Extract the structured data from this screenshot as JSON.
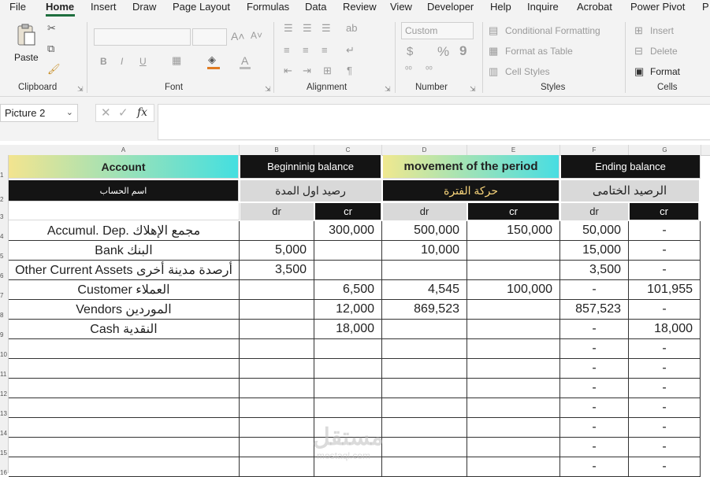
{
  "menu": [
    "File",
    "Home",
    "Insert",
    "Draw",
    "Page Layout",
    "Formulas",
    "Data",
    "Review",
    "View",
    "Developer",
    "Help",
    "Inquire",
    "Acrobat",
    "Power Pivot",
    "P"
  ],
  "ribbon": {
    "clipboard": {
      "label": "Clipboard",
      "paste": "Paste"
    },
    "font": {
      "label": "Font",
      "bold": "B",
      "italic": "I",
      "underline": "U",
      "grow": "A˄",
      "shrink": "A˅",
      "color_a": "A"
    },
    "alignment": {
      "label": "Alignment"
    },
    "number": {
      "label": "Number",
      "format_value": "Custom",
      "currency": "$",
      "percent": "%",
      "comma": "9"
    },
    "styles": {
      "label": "Styles",
      "conditional": "Conditional Formatting",
      "format_table": "Format as Table",
      "cell_styles": "Cell Styles"
    },
    "cells": {
      "label": "Cells",
      "insert": "Insert",
      "delete": "Delete",
      "format": "Format"
    }
  },
  "formula_bar": {
    "name_box": "Picture 2",
    "fx": "fx",
    "formula": ""
  },
  "columns": [
    "A",
    "B",
    "C",
    "D",
    "E",
    "F",
    "G"
  ],
  "rows": [
    "1",
    "2",
    "3",
    "4",
    "5",
    "6",
    "7",
    "8",
    "9",
    "10",
    "11",
    "12",
    "13",
    "14",
    "15",
    "16"
  ],
  "header": {
    "account": "Account",
    "beginning": "Beginninig balance",
    "movement": "movement of the period",
    "ending": "Ending balance",
    "account_ar": "اسم الحساب",
    "beginning_ar": "رصيد اول المدة",
    "movement_ar": "حركة الفترة",
    "ending_ar": "الرصيد الختامى",
    "dr": "dr",
    "cr": "cr"
  },
  "table_rows": [
    {
      "account": "Accumul. Dep. مجمع الإهلاك",
      "b_dr": "",
      "b_cr": "300,000",
      "m_dr": "500,000",
      "m_cr": "150,000",
      "e_dr": "50,000",
      "e_cr": "-"
    },
    {
      "account": "Bank البنك",
      "b_dr": "5,000",
      "b_cr": "",
      "m_dr": "10,000",
      "m_cr": "",
      "e_dr": "15,000",
      "e_cr": "-"
    },
    {
      "account": "Other Current Assets أرصدة مدينة أخرى",
      "b_dr": "3,500",
      "b_cr": "",
      "m_dr": "",
      "m_cr": "",
      "e_dr": "3,500",
      "e_cr": "-"
    },
    {
      "account": "Customer العملاء",
      "b_dr": "",
      "b_cr": "6,500",
      "m_dr": "4,545",
      "m_cr": "100,000",
      "e_dr": "-",
      "e_cr": "101,955"
    },
    {
      "account": "Vendors الموردين",
      "b_dr": "",
      "b_cr": "12,000",
      "m_dr": "869,523",
      "m_cr": "",
      "e_dr": "857,523",
      "e_cr": "-"
    },
    {
      "account": "Cash النقدية",
      "b_dr": "",
      "b_cr": "18,000",
      "m_dr": "",
      "m_cr": "",
      "e_dr": "-",
      "e_cr": "18,000"
    },
    {
      "account": "",
      "b_dr": "",
      "b_cr": "",
      "m_dr": "",
      "m_cr": "",
      "e_dr": "-",
      "e_cr": "-"
    },
    {
      "account": "",
      "b_dr": "",
      "b_cr": "",
      "m_dr": "",
      "m_cr": "",
      "e_dr": "-",
      "e_cr": "-"
    },
    {
      "account": "",
      "b_dr": "",
      "b_cr": "",
      "m_dr": "",
      "m_cr": "",
      "e_dr": "-",
      "e_cr": "-"
    },
    {
      "account": "",
      "b_dr": "",
      "b_cr": "",
      "m_dr": "",
      "m_cr": "",
      "e_dr": "-",
      "e_cr": "-"
    },
    {
      "account": "",
      "b_dr": "",
      "b_cr": "",
      "m_dr": "",
      "m_cr": "",
      "e_dr": "-",
      "e_cr": "-"
    },
    {
      "account": "",
      "b_dr": "",
      "b_cr": "",
      "m_dr": "",
      "m_cr": "",
      "e_dr": "-",
      "e_cr": "-"
    },
    {
      "account": "",
      "b_dr": "",
      "b_cr": "",
      "m_dr": "",
      "m_cr": "",
      "e_dr": "-",
      "e_cr": "-"
    }
  ],
  "watermark": {
    "ar": "مستقل",
    "en": "mostaql.com"
  },
  "colors": {
    "cyan_gradient_start": "#f0e68c",
    "cyan_gradient_end": "#40e0d0",
    "black": "#141414",
    "gray": "#d9d9d9",
    "accent": "#1e6e3e"
  }
}
